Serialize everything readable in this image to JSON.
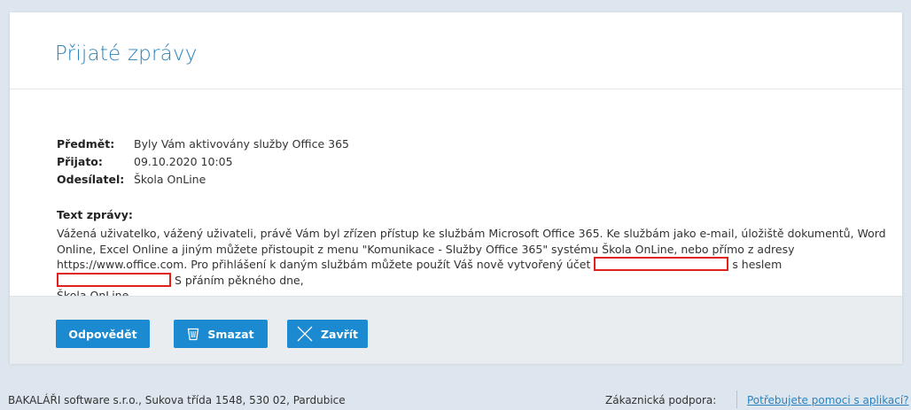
{
  "page": {
    "title": "Přijaté zprávy"
  },
  "message": {
    "subject_label": "Předmět:",
    "subject": "Byly Vám aktivovány služby Office 365",
    "received_label": "Přijato:",
    "received": "09.10.2020 10:05",
    "sender_label": "Odesílatel:",
    "sender": "Škola OnLine",
    "body_label": "Text zprávy:",
    "body_part1": "Vážená uživatelko, vážený uživateli, právě Vám byl zřízen přístup ke službám Microsoft Office 365. Ke službám jako e-mail, úložiště dokumentů, Word Online, Excel Online a jiným můžete přistoupit z menu \"Komunikace - Služby Office 365\" systému Škola OnLine, nebo přímo z adresy https://www.office.com. Pro přihlášení k daným službám můžete použít Váš nově vytvořený účet",
    "body_part2": "s heslem",
    "body_part3": "S přáním pěkného dne,",
    "body_signature": "Škola OnLine"
  },
  "actions": {
    "reply": "Odpovědět",
    "delete": "Smazat",
    "close": "Zavřít"
  },
  "footer": {
    "company": "BAKALÁŘI software s.r.o., Sukova třída 1548, 530 02, Pardubice",
    "support_label": "Zákaznická podpora:",
    "help_link": "Potřebujete pomoci s aplikací?"
  },
  "colors": {
    "accent": "#1b8ad0",
    "title": "#2a83bd",
    "redaction": "#e0201c",
    "background": "#dde6ee"
  },
  "icons": {
    "delete": "trash-icon",
    "close": "close-x-icon"
  }
}
